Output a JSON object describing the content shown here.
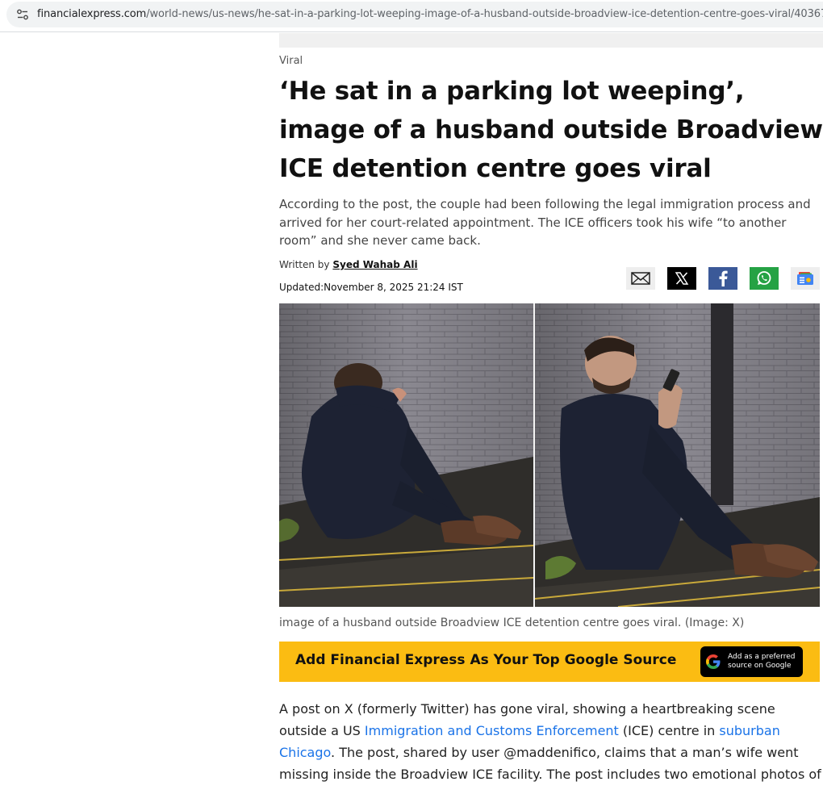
{
  "browser": {
    "url_host": "financialexpress.com",
    "url_path": "/world-news/us-news/he-sat-in-a-parking-lot-weeping-image-of-a-husband-outside-broadview-ice-detention-centre-goes-viral/4036711"
  },
  "article": {
    "category": "Viral",
    "headline": "‘He sat in a parking lot weeping’, image of a husband outside Broadview ICE detention centre goes viral",
    "summary": "According to the post, the couple had been following the legal immigration process and arrived for her court-related appointment. The ICE officers took his wife “to another room” and she never came back.",
    "byline_prefix": "Written by",
    "author": "Syed Wahab Ali",
    "updated": "Updated:November 8, 2025 21:24 IST",
    "image_caption": "image of a husband outside Broadview ICE detention centre goes viral. (Image: X)"
  },
  "share": {
    "icons": [
      "mail-icon",
      "x-icon",
      "facebook-icon",
      "whatsapp-icon",
      "google-news-icon"
    ],
    "colors": {
      "x": "#000000",
      "facebook": "#3b5998",
      "whatsapp": "#25a244"
    }
  },
  "google_banner": {
    "text": "Add Financial Express As Your Top Google Source",
    "button_line1": "Add as a preferred",
    "button_line2": "source on Google",
    "bg_color": "#fbbc12"
  },
  "body": {
    "p1_a": "A post on X (formerly Twitter) has gone viral, showing a heartbreaking scene outside a US ",
    "link1": "Immigration and Customs Enforcement",
    "p1_b": " (ICE) centre in ",
    "link2": "suburban Chicago",
    "p1_c": ". The post, shared by user @maddenifico, claims that a man’s wife went missing inside the Broadview ICE facility. The post includes two emotional photos of"
  }
}
